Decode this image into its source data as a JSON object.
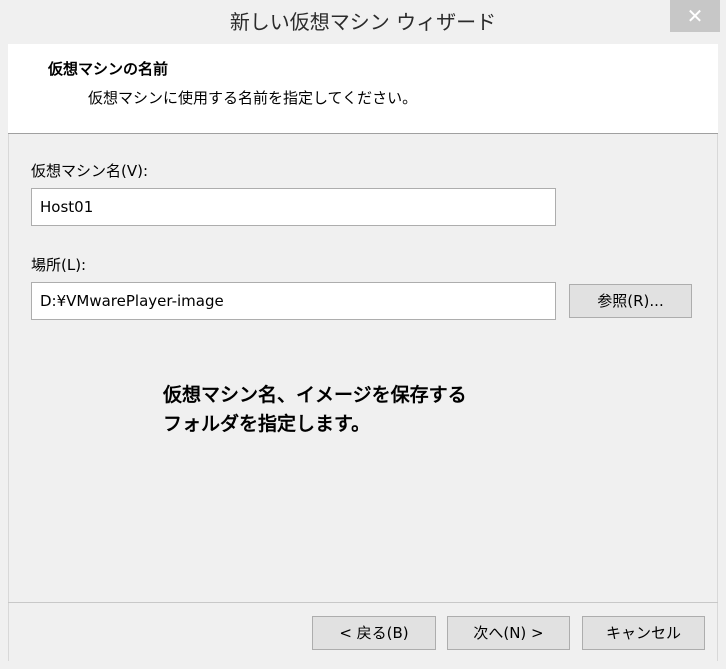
{
  "window": {
    "title": "新しい仮想マシン ウィザード",
    "close_glyph": "✕"
  },
  "header": {
    "title": "仮想マシンの名前",
    "subtitle": "仮想マシンに使用する名前を指定してください。"
  },
  "form": {
    "vm_name_label": "仮想マシン名(V):",
    "vm_name_value": "Host01",
    "location_label": "場所(L):",
    "location_value": "D:¥VMwarePlayer-image",
    "browse_label": "参照(R)..."
  },
  "annotation": {
    "line1": "仮想マシン名、イメージを保存する",
    "line2": "フォルダを指定します。"
  },
  "footer": {
    "back_label": "< 戻る(B)",
    "next_label": "次へ(N) >",
    "cancel_label": "キャンセル"
  }
}
